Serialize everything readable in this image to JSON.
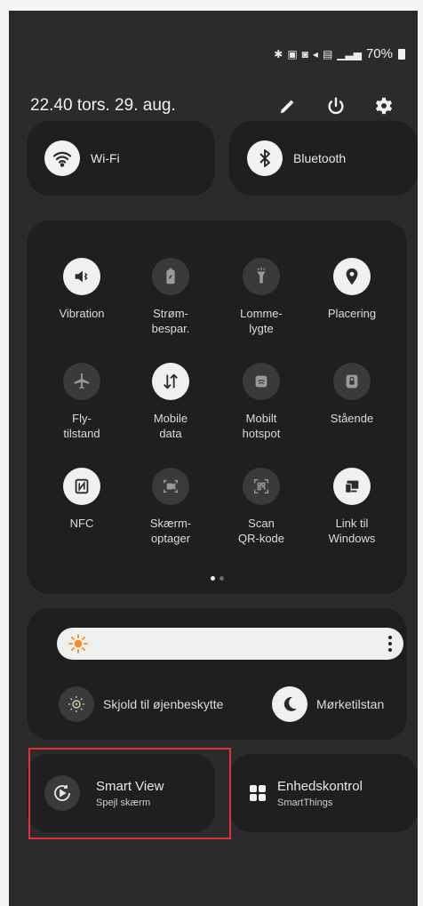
{
  "status_bar": {
    "battery": "70%"
  },
  "header": {
    "datetime": "22.40  tors. 29. aug."
  },
  "icons": {
    "edit": "pencil-icon",
    "power": "power-icon",
    "settings": "gear-icon"
  },
  "wifi": {
    "label": "Wi-Fi"
  },
  "bluetooth": {
    "label": "Bluetooth"
  },
  "quick_tiles": [
    {
      "label": "Vibration"
    },
    {
      "label": "Strøm-\nbespar."
    },
    {
      "label": "Lomme-\nlygte"
    },
    {
      "label": "Placering"
    },
    {
      "label": "Fly-\ntilstand"
    },
    {
      "label": "Mobile\ndata"
    },
    {
      "label": "Mobilt\nhotspot"
    },
    {
      "label": "Stående"
    },
    {
      "label": "NFC"
    },
    {
      "label": "Skærm-\noptager"
    },
    {
      "label": "Scan\nQR-kode"
    },
    {
      "label": "Link til\nWindows"
    }
  ],
  "brightness": {
    "level": 0.05,
    "eye_comfort": "Skjold til øjenbeskytte",
    "dark_mode": "Mørketilstan"
  },
  "smart_view": {
    "title": "Smart View",
    "subtitle": "Spejl skærm"
  },
  "device_control": {
    "title": "Enhedskontrol",
    "subtitle": "SmartThings"
  },
  "colors": {
    "panel": "#1f1f1f",
    "background": "#2b2b2b",
    "highlight": "#e0303a",
    "sun": "#ff8a1c"
  }
}
